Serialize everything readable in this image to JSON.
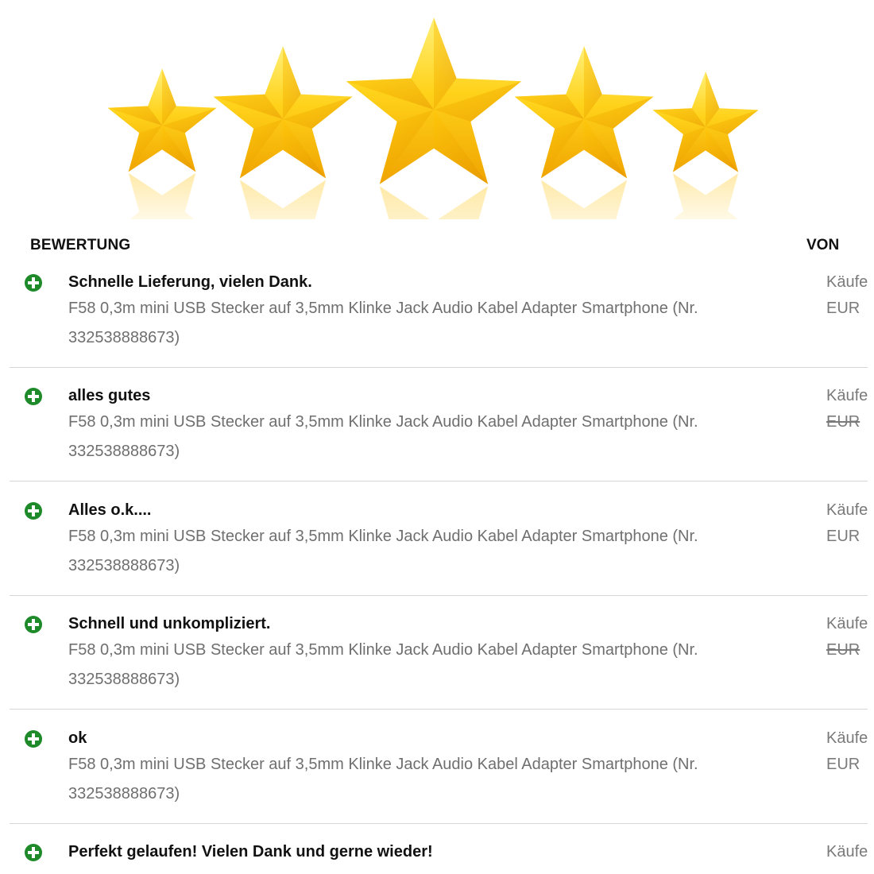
{
  "colors": {
    "positive_icon": "#1e8a2a",
    "star_gold": "#f6b800",
    "star_light": "#ffe46a",
    "title_text": "#111111",
    "muted_text": "#6f6f6f"
  },
  "rating_banner": {
    "stars_count": 5,
    "icon": "star-icon"
  },
  "header": {
    "rating_label": "BEWERTUNG",
    "from_label": "VON"
  },
  "feedback": [
    {
      "type": "positive",
      "icon": "plus-circle-icon",
      "title": "Schnelle Lieferung, vielen Dank.",
      "item": "F58 0,3m mini USB Stecker auf 3,5mm Klinke Jack Audio Kabel Adapter Smartphone (Nr. 332538888673)",
      "buyer": "Käufe",
      "price": "EUR",
      "price_struck": false
    },
    {
      "type": "positive",
      "icon": "plus-circle-icon",
      "title": "alles gutes",
      "item": "F58 0,3m mini USB Stecker auf 3,5mm Klinke Jack Audio Kabel Adapter Smartphone (Nr. 332538888673)",
      "buyer": "Käufe",
      "price": "EUR",
      "price_struck": true
    },
    {
      "type": "positive",
      "icon": "plus-circle-icon",
      "title": "Alles o.k....",
      "item": "F58 0,3m mini USB Stecker auf 3,5mm Klinke Jack Audio Kabel Adapter Smartphone (Nr. 332538888673)",
      "buyer": "Käufe",
      "price": "EUR",
      "price_struck": false
    },
    {
      "type": "positive",
      "icon": "plus-circle-icon",
      "title": "Schnell und unkompliziert.",
      "item": "F58 0,3m mini USB Stecker auf 3,5mm Klinke Jack Audio Kabel Adapter Smartphone (Nr. 332538888673)",
      "buyer": "Käufe",
      "price": "EUR",
      "price_struck": true
    },
    {
      "type": "positive",
      "icon": "plus-circle-icon",
      "title": "ok",
      "item": "F58 0,3m mini USB Stecker auf 3,5mm Klinke Jack Audio Kabel Adapter Smartphone (Nr. 332538888673)",
      "buyer": "Käufe",
      "price": "EUR",
      "price_struck": false
    },
    {
      "type": "positive",
      "icon": "plus-circle-icon",
      "title": "Perfekt gelaufen! Vielen Dank und gerne wieder!",
      "buyer": "Käufe"
    }
  ]
}
